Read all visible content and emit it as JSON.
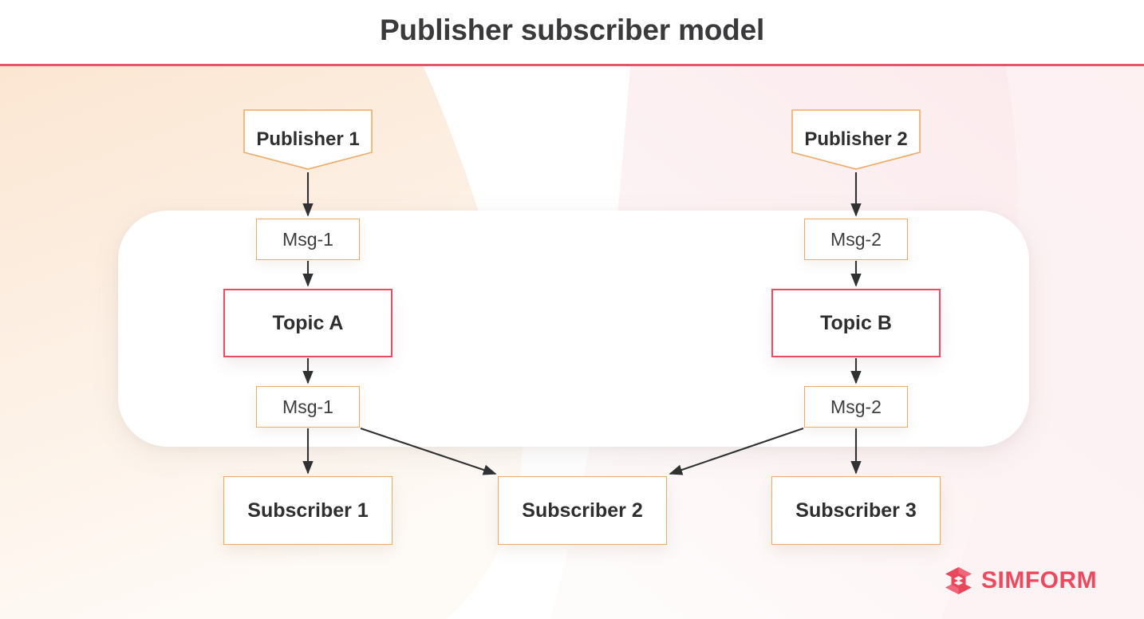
{
  "header": {
    "title": "Publisher subscriber model",
    "rule_color": "#e8566b"
  },
  "palette": {
    "orange_border": "#f2a964",
    "red_border": "#ef4a63",
    "text_dark": "#2f2f31",
    "cream_blob": "#fcead9",
    "pink_blob": "#fdf0f1",
    "panel_white": "#ffffff",
    "brand_red": "#ee4a5f"
  },
  "diagram": {
    "publishers": [
      {
        "label": "Publisher 1"
      },
      {
        "label": "Publisher 2"
      }
    ],
    "inbound_messages": [
      {
        "label": "Msg-1"
      },
      {
        "label": "Msg-2"
      }
    ],
    "topics": [
      {
        "label": "Topic A"
      },
      {
        "label": "Topic B"
      }
    ],
    "outbound_messages": [
      {
        "label": "Msg-1"
      },
      {
        "label": "Msg-2"
      }
    ],
    "subscribers": [
      {
        "label": "Subscriber 1"
      },
      {
        "label": "Subscriber 2"
      },
      {
        "label": "Subscriber 3"
      }
    ]
  },
  "logo": {
    "text": "SIMFORM",
    "mark": "simform-diamond-icon"
  }
}
